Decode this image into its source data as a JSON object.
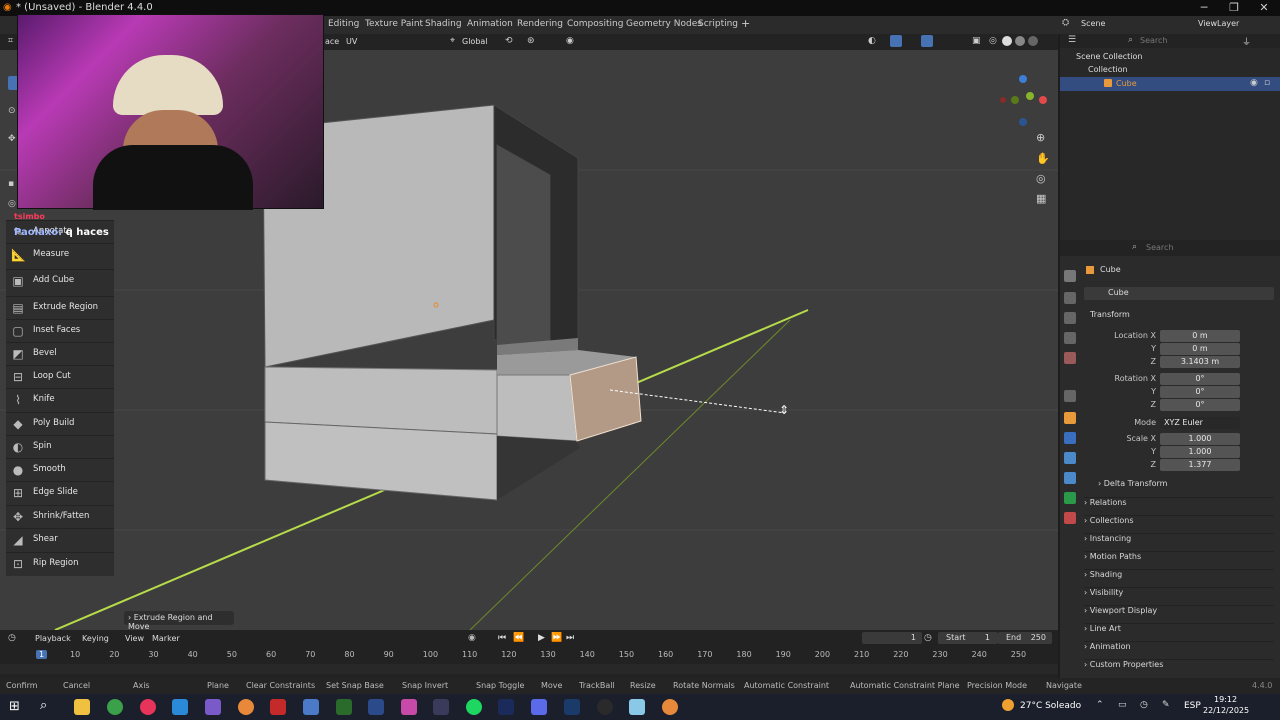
{
  "window": {
    "title": "* (Unsaved) - Blender 4.4.0",
    "minimize": "─",
    "maximize": "❐",
    "close": "✕"
  },
  "workspaces": [
    "Editing",
    "Texture Paint",
    "Shading",
    "Animation",
    "Rendering",
    "Compositing",
    "Geometry Nodes",
    "Scripting"
  ],
  "add_tab": "+",
  "scene": {
    "label": "Scene",
    "view_layer": "ViewLayer"
  },
  "header": {
    "face_menu": "ace",
    "uv_menu": "UV",
    "orientation": "Global"
  },
  "toolbar": {
    "tools": [
      {
        "label": "Annotate",
        "icon": "✎"
      },
      {
        "label": "Measure",
        "icon": "📐"
      },
      {
        "label": "Add Cube",
        "icon": "▣"
      },
      {
        "label": "Extrude Region",
        "icon": "▤"
      },
      {
        "label": "Inset Faces",
        "icon": "▢"
      },
      {
        "label": "Bevel",
        "icon": "◩"
      },
      {
        "label": "Loop Cut",
        "icon": "⊟"
      },
      {
        "label": "Knife",
        "icon": "⌇"
      },
      {
        "label": "Poly Build",
        "icon": "◆"
      },
      {
        "label": "Spin",
        "icon": "◐"
      },
      {
        "label": "Smooth",
        "icon": "●"
      },
      {
        "label": "Edge Slide",
        "icon": "⊞"
      },
      {
        "label": "Shrink/Fatten",
        "icon": "✥"
      },
      {
        "label": "Shear",
        "icon": "◢"
      },
      {
        "label": "Rip Region",
        "icon": "⊡"
      }
    ]
  },
  "chat": {
    "user1": "tsimbo",
    "user2": "Paolaxo:",
    "message": "q haces"
  },
  "operator_panel": "Extrude Region and Move",
  "outliner": {
    "search_placeholder": "Search",
    "scene_collection": "Scene Collection",
    "collection": "Collection",
    "cube": "Cube"
  },
  "properties": {
    "search_placeholder": "Search",
    "object_name": "Cube",
    "object_field": "Cube",
    "transform": "Transform",
    "location": {
      "label": "Location X",
      "x": "0 m",
      "y": "0 m",
      "z": "3.1403 m"
    },
    "rotation": {
      "label": "Rotation X",
      "x": "0°",
      "y": "0°",
      "z": "0°"
    },
    "mode": {
      "label": "Mode",
      "value": "XYZ Euler"
    },
    "scale": {
      "label": "Scale X",
      "x": "1.000",
      "y": "1.000",
      "z": "1.377"
    },
    "axis_y": "Y",
    "axis_z": "Z",
    "delta": "Delta Transform",
    "panels": [
      "Relations",
      "Collections",
      "Instancing",
      "Motion Paths",
      "Shading",
      "Visibility",
      "Viewport Display",
      "Line Art",
      "Animation",
      "Custom Properties"
    ]
  },
  "timeline": {
    "playback": "Playback",
    "keying": "Keying",
    "view": "View",
    "marker": "Marker",
    "current_frame": "1",
    "start_label": "Start",
    "start": "1",
    "end_label": "End",
    "end": "250",
    "ticks": [
      "1",
      "10",
      "20",
      "30",
      "40",
      "50",
      "60",
      "70",
      "80",
      "90",
      "100",
      "110",
      "120",
      "130",
      "140",
      "150",
      "160",
      "170",
      "180",
      "190",
      "200",
      "210",
      "220",
      "230",
      "240",
      "250"
    ]
  },
  "statusbar": {
    "items": [
      "Confirm",
      "Cancel",
      "Axis",
      "Plane",
      "Clear Constraints",
      "Set Snap Base",
      "Snap Invert",
      "Snap Toggle",
      "Move",
      "TrackBall",
      "Resize",
      "Rotate Normals",
      "Automatic Constraint",
      "Automatic Constraint Plane",
      "Precision Mode",
      "Navigate"
    ],
    "version": "4.4.0"
  },
  "taskbar": {
    "weather": "27°C  Soleado",
    "lang": "ESP",
    "time": "19:12",
    "date": "22/12/2025"
  },
  "colors": {
    "accent": "#4772b3",
    "extrude_face": "#b39a86",
    "y_axis": "#9ac43a"
  }
}
